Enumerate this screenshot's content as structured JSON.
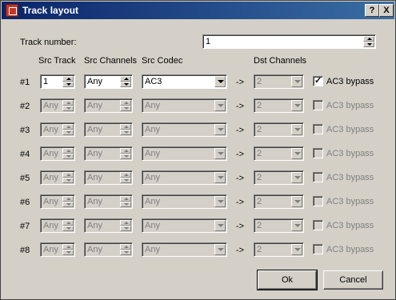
{
  "window": {
    "title": "Track layout",
    "help_label": "?",
    "close_label": "X"
  },
  "track_number": {
    "label": "Track number:",
    "value": "1"
  },
  "headers": {
    "src_track": "Src Track",
    "src_channels": "Src Channels",
    "src_codec": "Src Codec",
    "dst_channels": "Dst Channels"
  },
  "arrow": "->",
  "rows": [
    {
      "label": "#1",
      "src_track": "1",
      "src_channels": "Any",
      "src_codec": "AC3",
      "dst_channels": "2",
      "bypass_label": "AC3 bypass",
      "bypass_checked": true,
      "enabled": true
    },
    {
      "label": "#2",
      "src_track": "Any",
      "src_channels": "Any",
      "src_codec": "Any",
      "dst_channels": "2",
      "bypass_label": "AC3 bypass",
      "bypass_checked": false,
      "enabled": false
    },
    {
      "label": "#3",
      "src_track": "Any",
      "src_channels": "Any",
      "src_codec": "Any",
      "dst_channels": "2",
      "bypass_label": "AC3 bypass",
      "bypass_checked": false,
      "enabled": false
    },
    {
      "label": "#4",
      "src_track": "Any",
      "src_channels": "Any",
      "src_codec": "Any",
      "dst_channels": "2",
      "bypass_label": "AC3 bypass",
      "bypass_checked": false,
      "enabled": false
    },
    {
      "label": "#5",
      "src_track": "Any",
      "src_channels": "Any",
      "src_codec": "Any",
      "dst_channels": "2",
      "bypass_label": "AC3 bypass",
      "bypass_checked": false,
      "enabled": false
    },
    {
      "label": "#6",
      "src_track": "Any",
      "src_channels": "Any",
      "src_codec": "Any",
      "dst_channels": "2",
      "bypass_label": "AC3 bypass",
      "bypass_checked": false,
      "enabled": false
    },
    {
      "label": "#7",
      "src_track": "Any",
      "src_channels": "Any",
      "src_codec": "Any",
      "dst_channels": "2",
      "bypass_label": "AC3 bypass",
      "bypass_checked": false,
      "enabled": false
    },
    {
      "label": "#8",
      "src_track": "Any",
      "src_channels": "Any",
      "src_codec": "Any",
      "dst_channels": "2",
      "bypass_label": "AC3 bypass",
      "bypass_checked": false,
      "enabled": false
    }
  ],
  "buttons": {
    "ok": "Ok",
    "cancel": "Cancel"
  },
  "icons": {
    "app": "app-icon",
    "spin": "spin-arrows-icon",
    "dropdown": "chevron-down-icon",
    "check": "checkmark-icon"
  },
  "colors": {
    "titlebar_start": "#0a246a",
    "titlebar_end": "#3a6ea5",
    "face": "#d4d0c8",
    "disabled_text": "#808080"
  }
}
